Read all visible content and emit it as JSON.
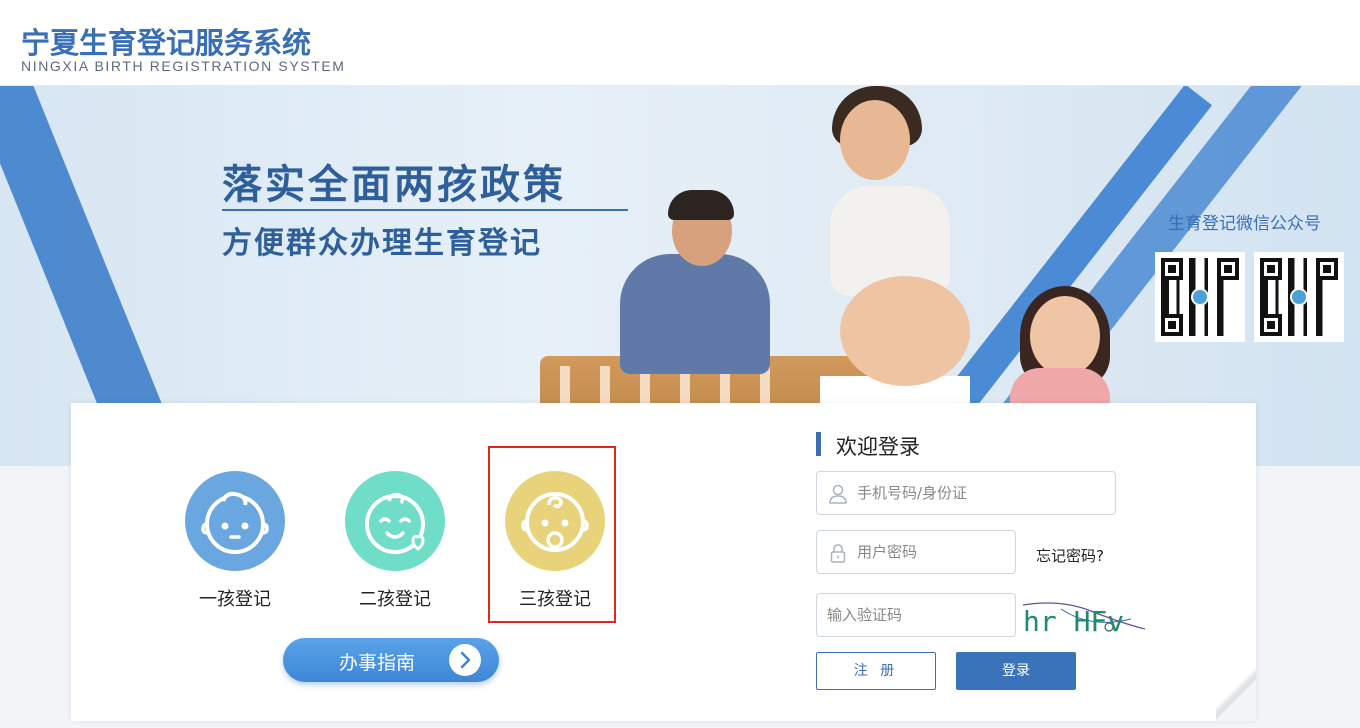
{
  "header": {
    "title": "宁夏生育登记服务系统",
    "subtitle": "NINGXIA BIRTH REGISTRATION SYSTEM"
  },
  "banner": {
    "slogan_main": "落实全面两孩政策",
    "slogan_sub": "方便群众办理生育登记",
    "wechat_title": "生育登记微信公众号"
  },
  "registration": {
    "items": [
      {
        "label": "一孩登记",
        "color": "#6aa6e0"
      },
      {
        "label": "二孩登记",
        "color": "#6fddc7"
      },
      {
        "label": "三孩登记",
        "color": "#e8d37a"
      }
    ],
    "guide_label": "办事指南"
  },
  "login": {
    "title": "欢迎登录",
    "phone_placeholder": "手机号码/身份证",
    "password_placeholder": "用户密码",
    "forgot_label": "忘记密码?",
    "captcha_placeholder": "输入验证码",
    "captcha_text": "hr HFv",
    "register_label": "注 册",
    "login_label": "登录"
  },
  "colors": {
    "brand": "#3a6fb5",
    "highlight": "#e3261f"
  }
}
